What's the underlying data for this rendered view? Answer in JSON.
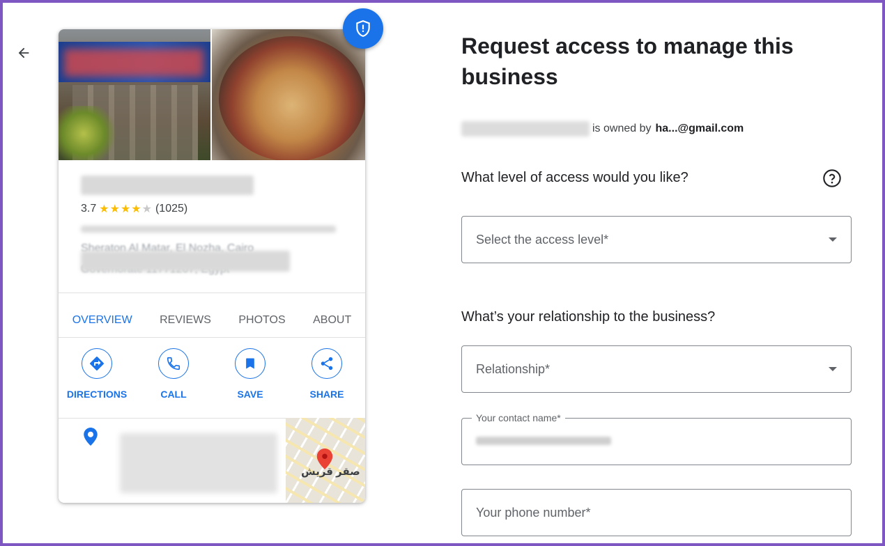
{
  "card": {
    "rating_value": "3.7",
    "stars": "★★★★",
    "star_off": "★",
    "review_count": "(1025)",
    "address_line2": "Sheraton Al Matar, El Nozha, Cairo",
    "address_line3": "Governorate 11771207, Egypt",
    "tabs": [
      "OVERVIEW",
      "REVIEWS",
      "PHOTOS",
      "ABOUT"
    ],
    "actions": [
      "DIRECTIONS",
      "CALL",
      "SAVE",
      "SHARE"
    ],
    "map_label": "صقر قريش"
  },
  "form": {
    "title": "Request access to manage this business",
    "owned_by_text": "is owned by",
    "owner_email": "ha...@gmail.com",
    "access_question": "What level of access would you like?",
    "access_placeholder": "Select the access level*",
    "relationship_question": "What’s your relationship to the business?",
    "relationship_placeholder": "Relationship*",
    "contact_name_label": "Your contact name*",
    "phone_placeholder": "Your phone number*"
  },
  "colors": {
    "accent": "#1a73e8",
    "star": "#fbbc04",
    "map_pin": "#ea4335",
    "frame_border": "#7e57c2"
  },
  "icons": {
    "back": "arrow-left-icon",
    "shield": "shield-icon",
    "help": "help-circle-icon",
    "directions": "directions-icon",
    "call": "phone-icon",
    "save": "bookmark-icon",
    "share": "share-icon",
    "location": "location-pin-icon"
  }
}
